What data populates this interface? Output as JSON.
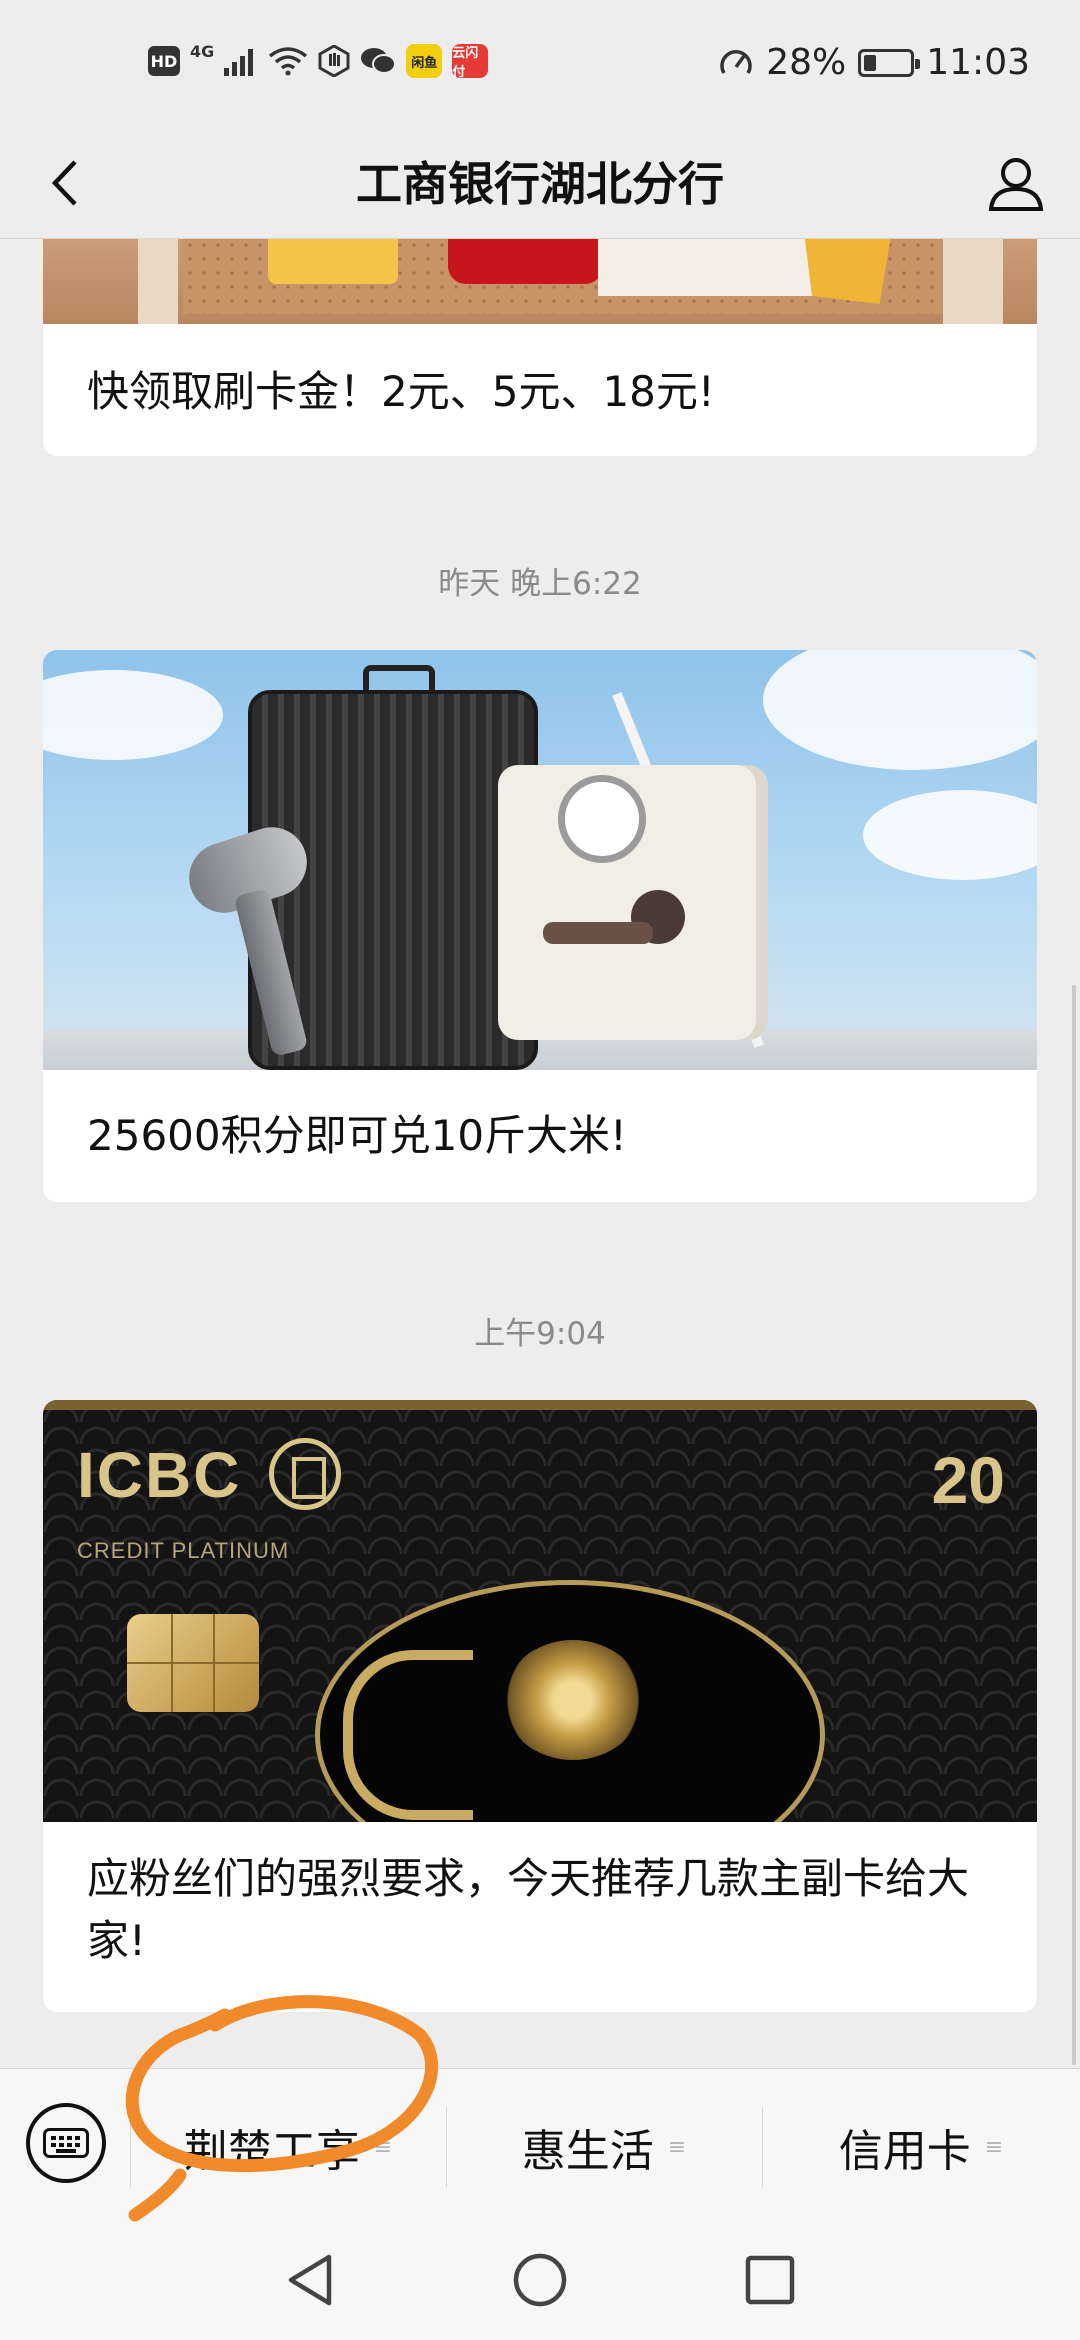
{
  "status_bar": {
    "hd": "HD",
    "network": "4G",
    "app_badge_1": "闲鱼",
    "app_badge_2": "云闪付",
    "battery_percent": "28%",
    "battery_level": 0.28,
    "time": "11:03",
    "icons": [
      "hd-badge",
      "signal-icon",
      "wifi-icon",
      "hand-icon",
      "wechat-icon",
      "app-badge",
      "app-badge",
      "speedometer-icon",
      "battery-charging-icon"
    ]
  },
  "header": {
    "title": "工商银行湖北分行",
    "back_icon": "chevron-left-icon",
    "profile_icon": "person-icon"
  },
  "feed": {
    "items": [
      {
        "title": "快领取刷卡金！2元、5元、18元!"
      },
      {
        "timestamp": "昨天 晚上6:22",
        "title": "25600积分即可兑10斤大米!"
      },
      {
        "timestamp": "上午9:04",
        "title": "应粉丝们的强烈要求，今天推荐几款主副卡给大家!",
        "image_text": {
          "brand": "ICBC",
          "subtitle": "CREDIT PLATINUM",
          "badge": "20"
        }
      }
    ]
  },
  "menu": {
    "keyboard_icon": "keyboard-icon",
    "items": [
      {
        "label": "荆楚工享"
      },
      {
        "label": "惠生活"
      },
      {
        "label": "信用卡"
      }
    ],
    "lines_glyph": "≡"
  },
  "nav": {
    "icons": [
      "back-triangle-icon",
      "home-circle-icon",
      "recents-square-icon"
    ]
  },
  "colors": {
    "background": "#ededed",
    "card": "#ffffff",
    "annotation": "#f08a2a",
    "timestamp": "#8a8a8a"
  }
}
